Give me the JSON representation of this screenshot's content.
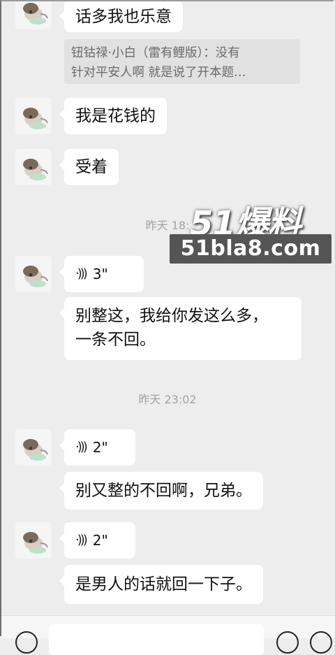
{
  "messages": [
    {
      "text": "话多我也乐意"
    },
    {
      "quote": [
        "钮钴禄·小白（雷有鲤版）：没有",
        "针对平安人啊 就是说了开本题…"
      ]
    },
    {
      "text": "我是花钱的"
    },
    {
      "text": "受着"
    },
    {
      "time": "昨天 18:"
    },
    {
      "voice": "3\""
    },
    {
      "lines": [
        "别整这，我给你发这么多，",
        "一条不回。"
      ]
    },
    {
      "time": "昨天 23:02"
    },
    {
      "voice": "2\""
    },
    {
      "text": "别又整的不回啊，兄弟。"
    },
    {
      "voice": "2\""
    },
    {
      "text": "是男人的话就回一下子。"
    }
  ],
  "watermark": {
    "big": "51爆料",
    "url": "51bla8.com"
  },
  "icons": {
    "voice": "voice-wave-icon",
    "avatar": "cartoon-avatar",
    "input_left": "voice-mode-icon",
    "input_right_1": "emoji-icon",
    "input_right_2": "plus-icon"
  },
  "colors": {
    "background": "#ededed",
    "bubble": "#ffffff",
    "quote": "#e1e1e1",
    "time": "#a2a2a2",
    "watermark_box": "#555555"
  }
}
